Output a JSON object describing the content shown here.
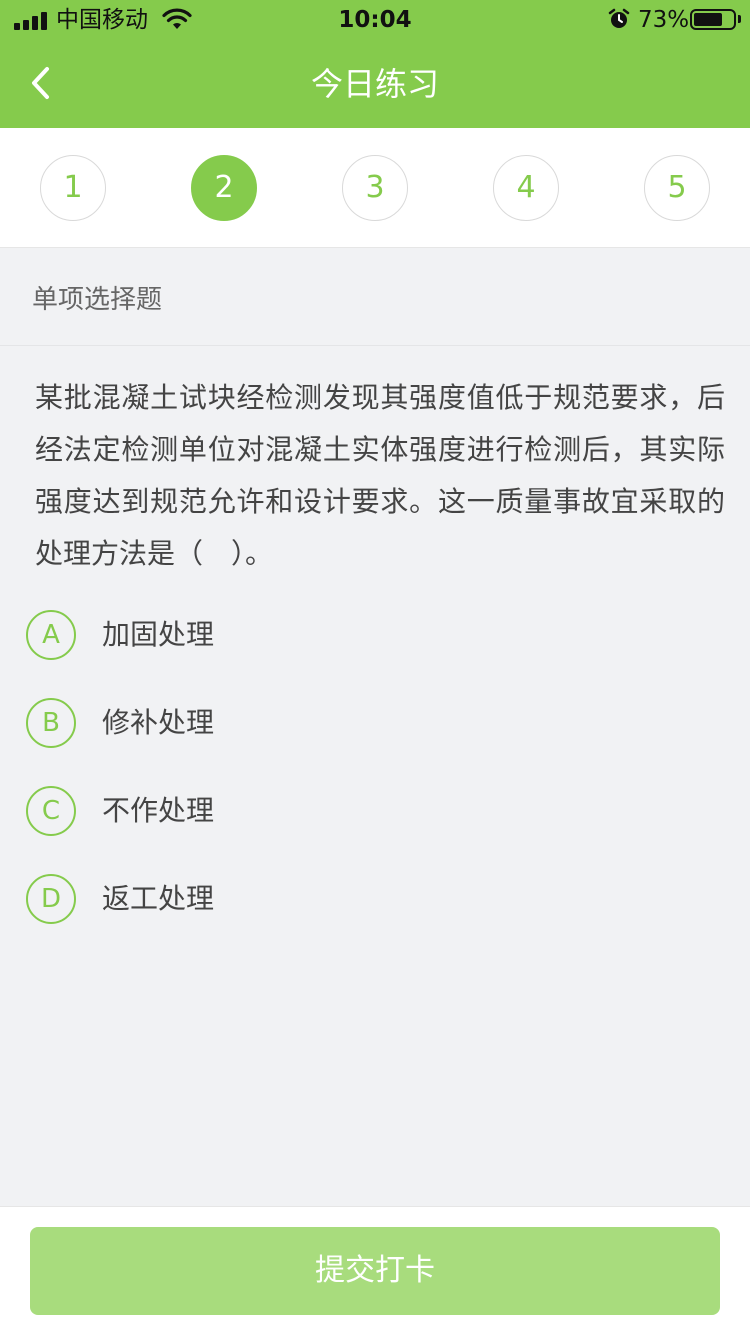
{
  "status_bar": {
    "carrier": "中国移动",
    "time": "10:04",
    "battery_percent": "73%",
    "battery_level": 0.73,
    "icons": [
      "signal-icon",
      "wifi-icon",
      "alarm-icon",
      "battery-icon"
    ]
  },
  "nav": {
    "title": "今日练习",
    "back_icon": "chevron-left-icon"
  },
  "question_numbers": {
    "items": [
      "1",
      "2",
      "3",
      "4",
      "5"
    ],
    "active_index": 1
  },
  "question": {
    "type_label": "单项选择题",
    "text": "某批混凝土试块经检测发现其强度值低于规范要求，后经法定检测单位对混凝土实体强度进行检测后，其实际强度达到规范允许和设计要求。这一质量事故宜采取的处理方法是（　）。",
    "options": [
      {
        "letter": "A",
        "text": "加固处理"
      },
      {
        "letter": "B",
        "text": "修补处理"
      },
      {
        "letter": "C",
        "text": "不作处理"
      },
      {
        "letter": "D",
        "text": "返工处理"
      }
    ]
  },
  "submit": {
    "label": "提交打卡"
  },
  "colors": {
    "accent": "#85cb4c",
    "submit_disabled": "#a8dc7d",
    "background": "#f1f2f4"
  }
}
